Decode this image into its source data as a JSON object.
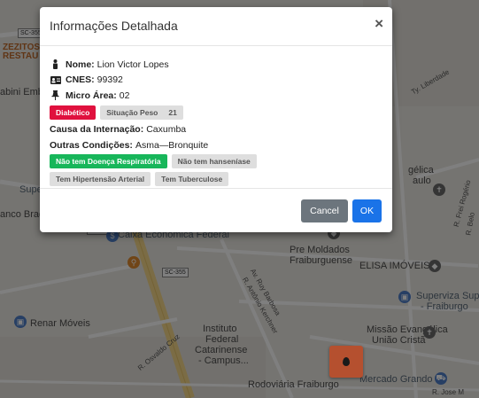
{
  "map": {
    "labels": {
      "zezitos": "ZEZITOS",
      "restau": "RESTAU",
      "abini": "abini Emb",
      "supe": "Supe",
      "anco": "anco Brad",
      "caixa": "Caixa Econômica Federal",
      "pre_moldados_1": "Pre Moldados",
      "pre_moldados_2": "Fraiburguense",
      "elisa": "ELISA IMÓVEIS",
      "superviza_1": "Superviza Super",
      "superviza_2": "- Fraiburgo",
      "renar": "Renar Móveis",
      "instituto_1": "Instituto",
      "instituto_2": "Federal",
      "instituto_3": "Catarinense",
      "instituto_4": "- Campus...",
      "missao_1": "Missão Evangélica",
      "missao_2": "União Cristã",
      "rodoviaria": "Rodoviária Fraiburgo",
      "mercado": "Mercado Grando",
      "gelica_1": "gélica",
      "gelica_2": "aulo",
      "sc355_a": "SC-355",
      "sc355_b": "SC-355",
      "sc355_c": "SC-355",
      "st_liberdade": "Ty. Liberdade",
      "st_frei": "R. Frei Rogério",
      "st_belo": "R. Belo",
      "st_antonio": "R. Antônio Kerch",
      "st_antonio2": "R. Antônio Kerchner",
      "st_ruy": "Av. Ruy Barbosa",
      "st_osvaldo": "R. Osvaldo Cruz",
      "st_jose": "R. Jose M"
    }
  },
  "modal": {
    "title": "Informações Detalhada",
    "close": "×",
    "fields": {
      "nome_label": "Nome:",
      "nome_value": "Lion Victor Lopes",
      "cnes_label": "CNES:",
      "cnes_value": "99392",
      "micro_label": "Micro Área:",
      "micro_value": "02",
      "causa_label": "Causa da Internação:",
      "causa_value": "Caxumba",
      "outras_label": "Outras Condições:",
      "outras_value": "Asma—Bronquite"
    },
    "badges": {
      "diabetico": "Diabético",
      "situacao_peso": "Situação Peso",
      "situacao_peso_value": "21",
      "respiratoria": "Não tem Doença Respiratória",
      "hanseniase": "Não tem hanseníase",
      "hipertensao": "Tem Hipertensão Arterial",
      "tuberculose": "Tem Tuberculose"
    },
    "footer": {
      "cancel": "Cancel",
      "ok": "OK"
    }
  },
  "colors": {
    "danger": "#e0113e",
    "success": "#17b65a",
    "primary": "#1a73e8",
    "secondary": "#6c757d"
  }
}
